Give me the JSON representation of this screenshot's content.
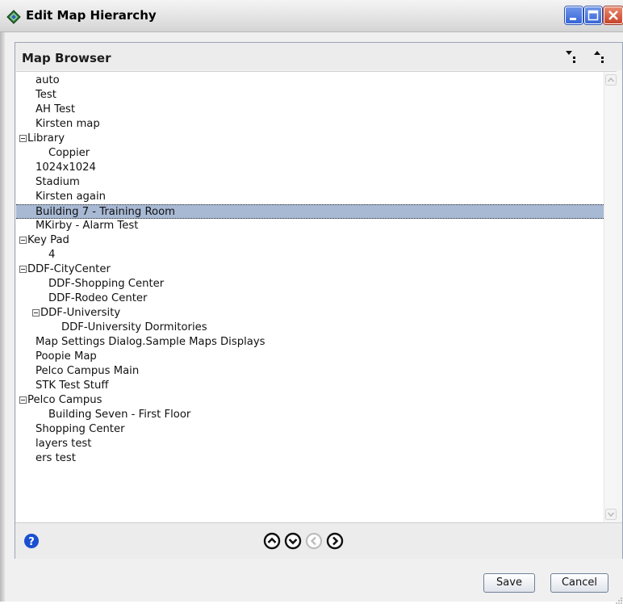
{
  "window": {
    "title": "Edit Map Hierarchy",
    "icon": "diamond-app-icon"
  },
  "panel": {
    "title": "Map Browser",
    "toolbar": {
      "expand_all_icon": "expand-all-icon",
      "collapse_all_icon": "collapse-all-icon"
    }
  },
  "tree": {
    "items": [
      {
        "label": "auto",
        "level": 1,
        "expandable": false,
        "selected": false
      },
      {
        "label": "Test",
        "level": 1,
        "expandable": false,
        "selected": false
      },
      {
        "label": "AH Test",
        "level": 1,
        "expandable": false,
        "selected": false
      },
      {
        "label": "Kirsten map",
        "level": 1,
        "expandable": false,
        "selected": false
      },
      {
        "label": "Library",
        "level": 1,
        "expandable": true,
        "selected": false
      },
      {
        "label": "Coppier",
        "level": 2,
        "expandable": false,
        "selected": false
      },
      {
        "label": "1024x1024",
        "level": 1,
        "expandable": false,
        "selected": false
      },
      {
        "label": "Stadium",
        "level": 1,
        "expandable": false,
        "selected": false
      },
      {
        "label": "Kirsten again",
        "level": 1,
        "expandable": false,
        "selected": false
      },
      {
        "label": "Building 7 - Training Room",
        "level": 1,
        "expandable": false,
        "selected": true
      },
      {
        "label": "MKirby - Alarm Test",
        "level": 1,
        "expandable": false,
        "selected": false
      },
      {
        "label": "Key Pad",
        "level": 1,
        "expandable": true,
        "selected": false
      },
      {
        "label": "4",
        "level": 2,
        "expandable": false,
        "selected": false
      },
      {
        "label": "DDF-CityCenter",
        "level": 1,
        "expandable": true,
        "selected": false
      },
      {
        "label": "DDF-Shopping Center",
        "level": 2,
        "expandable": false,
        "selected": false
      },
      {
        "label": "DDF-Rodeo Center",
        "level": 2,
        "expandable": false,
        "selected": false
      },
      {
        "label": "DDF-University",
        "level": 2,
        "expandable": true,
        "selected": false
      },
      {
        "label": "DDF-University Dormitories",
        "level": 3,
        "expandable": false,
        "selected": false
      },
      {
        "label": "Map Settings Dialog.Sample Maps Displays",
        "level": 1,
        "expandable": false,
        "selected": false
      },
      {
        "label": "Poopie Map",
        "level": 1,
        "expandable": false,
        "selected": false
      },
      {
        "label": "Pelco Campus Main",
        "level": 1,
        "expandable": false,
        "selected": false
      },
      {
        "label": "STK Test Stuff",
        "level": 1,
        "expandable": false,
        "selected": false
      },
      {
        "label": "Pelco Campus",
        "level": 1,
        "expandable": true,
        "selected": false
      },
      {
        "label": "Building Seven - First Floor",
        "level": 2,
        "expandable": false,
        "selected": false
      },
      {
        "label": "Shopping Center",
        "level": 1,
        "expandable": false,
        "selected": false
      },
      {
        "label": "layers test",
        "level": 1,
        "expandable": false,
        "selected": false
      },
      {
        "label": "ers test",
        "level": 1,
        "expandable": false,
        "selected": false
      }
    ]
  },
  "footer": {
    "help_icon": "help-icon",
    "nav": {
      "up_icon": "move-up-icon",
      "down_icon": "move-down-icon",
      "left_icon": "move-left-icon",
      "right_icon": "move-right-icon",
      "left_enabled": false
    }
  },
  "buttons": {
    "save": "Save",
    "cancel": "Cancel"
  },
  "colors": {
    "selection": "#a8b9d4",
    "title_close": "#c8432b",
    "title_button": "#3865d6",
    "help_blue": "#1a4fd0"
  }
}
